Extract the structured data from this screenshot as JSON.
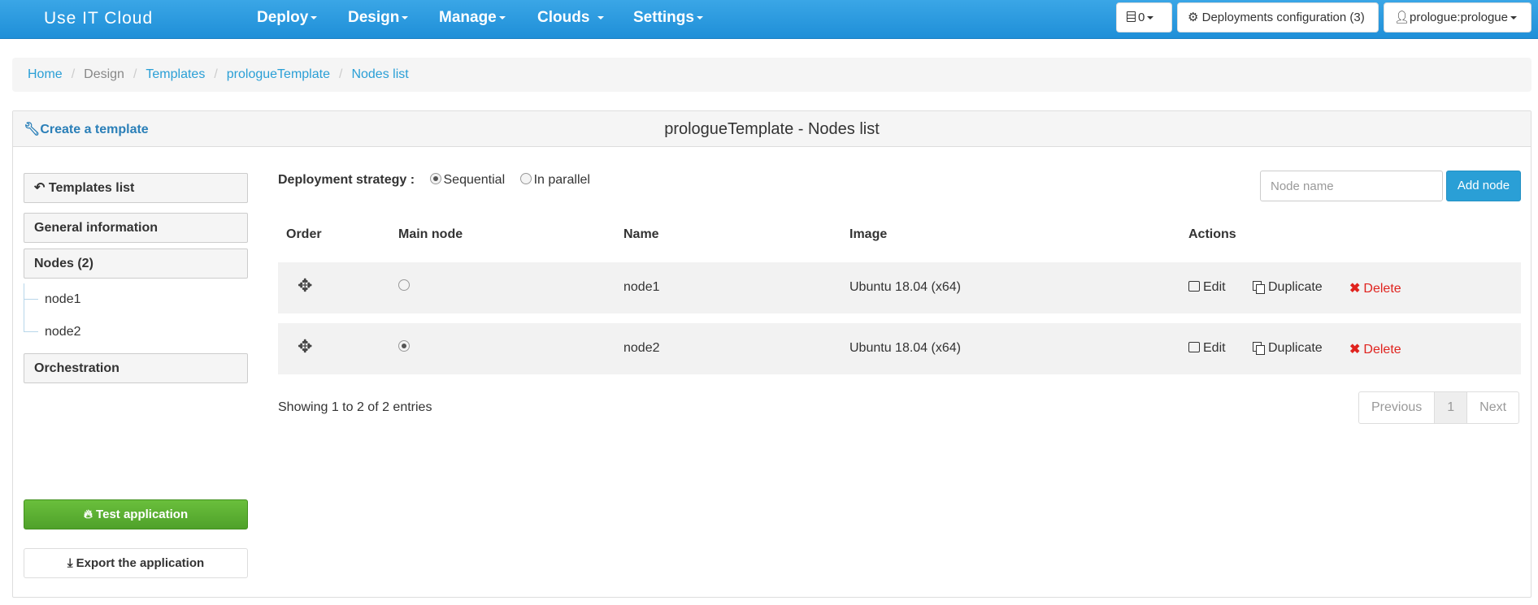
{
  "navbar": {
    "brand": "Use IT Cloud",
    "menus": [
      "Deploy",
      "Design",
      "Manage",
      "Clouds",
      "Settings"
    ],
    "server_count": "0",
    "deployments_config": "Deployments configuration (3)",
    "user": "prologue:prologue"
  },
  "breadcrumb": {
    "home": "Home",
    "design": "Design",
    "templates": "Templates",
    "template": "prologueTemplate",
    "current": "Nodes list"
  },
  "panel": {
    "create_link": "Create a template",
    "title": "prologueTemplate - Nodes list"
  },
  "sidebar": {
    "templates_list": "Templates list",
    "general_information": "General information",
    "nodes": "Nodes (2)",
    "tree": [
      "node1",
      "node2"
    ],
    "orchestration": "Orchestration",
    "test_application": "Test application",
    "export_application": "Export the application"
  },
  "strategy": {
    "label": "Deployment strategy :",
    "options": [
      "Sequential",
      "In parallel"
    ],
    "selected": "Sequential"
  },
  "search": {
    "placeholder": "Node name",
    "add_button": "Add node"
  },
  "table": {
    "headers": [
      "Order",
      "Main node",
      "Name",
      "Image",
      "Actions"
    ],
    "rows": [
      {
        "name": "node1",
        "image": "Ubuntu 18.04 (x64)",
        "main": false
      },
      {
        "name": "node2",
        "image": "Ubuntu 18.04 (x64)",
        "main": true
      }
    ],
    "actions": {
      "edit": "Edit",
      "duplicate": "Duplicate",
      "delete": "Delete"
    }
  },
  "footer": {
    "showing": "Showing 1 to 2 of 2 entries",
    "previous": "Previous",
    "page": "1",
    "next": "Next"
  },
  "colors": {
    "navbar": "#2a9fd6",
    "link": "#2a9fd6",
    "success": "#5cb132",
    "danger": "#e0231e"
  },
  "icons": [
    "server-icon",
    "gear-icon",
    "user-icon",
    "wrench-icon",
    "reply-icon",
    "move-icon",
    "edit-icon",
    "duplicate-icon",
    "delete-icon",
    "fire-icon",
    "export-icon"
  ]
}
